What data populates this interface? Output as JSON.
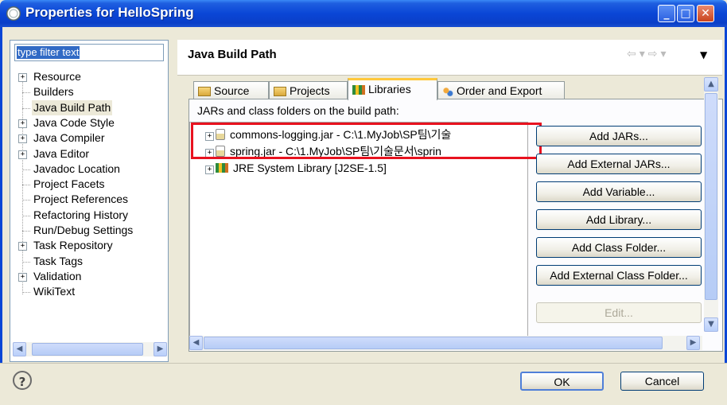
{
  "window": {
    "title": "Properties for HelloSpring"
  },
  "filter": {
    "placeholder": "type filter text"
  },
  "tree": [
    {
      "label": "Resource",
      "expandable": true
    },
    {
      "label": "Builders",
      "expandable": false
    },
    {
      "label": "Java Build Path",
      "expandable": false,
      "selected": true
    },
    {
      "label": "Java Code Style",
      "expandable": true
    },
    {
      "label": "Java Compiler",
      "expandable": true
    },
    {
      "label": "Java Editor",
      "expandable": true
    },
    {
      "label": "Javadoc Location",
      "expandable": false
    },
    {
      "label": "Project Facets",
      "expandable": false
    },
    {
      "label": "Project References",
      "expandable": false
    },
    {
      "label": "Refactoring History",
      "expandable": false
    },
    {
      "label": "Run/Debug Settings",
      "expandable": false
    },
    {
      "label": "Task Repository",
      "expandable": true
    },
    {
      "label": "Task Tags",
      "expandable": false
    },
    {
      "label": "Validation",
      "expandable": true
    },
    {
      "label": "WikiText",
      "expandable": false
    }
  ],
  "page": {
    "title": "Java Build Path"
  },
  "tabs": [
    {
      "label": "Source",
      "icon": "source-folder-icon"
    },
    {
      "label": "Projects",
      "icon": "projects-icon"
    },
    {
      "label": "Libraries",
      "icon": "libraries-icon",
      "active": true
    },
    {
      "label": "Order and Export",
      "icon": "order-icon"
    }
  ],
  "libraries": {
    "label": "JARs and class folders on the build path:",
    "items": [
      {
        "label": "commons-logging.jar - C:\\1.MyJob\\SP팀\\기술",
        "icon": "jar-icon"
      },
      {
        "label": "spring.jar - C:\\1.MyJob\\SP팀\\기술문서\\sprin",
        "icon": "jar-icon"
      },
      {
        "label": "JRE System Library [J2SE-1.5]",
        "icon": "library-icon"
      }
    ]
  },
  "buttons": {
    "add_jars": "Add JARs...",
    "add_external_jars": "Add External JARs...",
    "add_variable": "Add Variable...",
    "add_library": "Add Library...",
    "add_class_folder": "Add Class Folder...",
    "add_external_class_folder": "Add External Class Folder...",
    "edit": "Edit..."
  },
  "footer": {
    "ok": "OK",
    "cancel": "Cancel"
  }
}
